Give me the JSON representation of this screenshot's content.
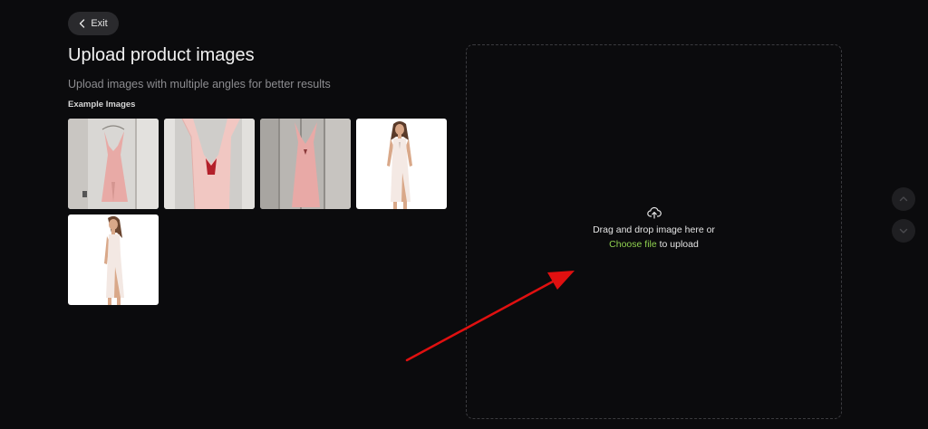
{
  "header": {
    "exit_label": "Exit",
    "title": "Upload product images",
    "subtitle": "Upload images with multiple angles for better results",
    "examples_label": "Example Images"
  },
  "examples": [
    {
      "icon": "pink-dress-on-hanger-photo"
    },
    {
      "icon": "pink-dress-closeup-photo"
    },
    {
      "icon": "pink-dress-on-wood-photo"
    },
    {
      "icon": "model-front-photo"
    },
    {
      "icon": "model-side-photo"
    }
  ],
  "dropzone": {
    "line1": "Drag and drop image here or",
    "choose_file": "Choose file",
    "line2_suffix": " to upload",
    "icon": "cloud-upload-icon"
  },
  "nav": {
    "up_icon": "chevron-up-icon",
    "down_icon": "chevron-down-icon"
  },
  "colors": {
    "background": "#0b0b0d",
    "accent": "#8fd14f",
    "annotation_arrow": "#e01010"
  }
}
